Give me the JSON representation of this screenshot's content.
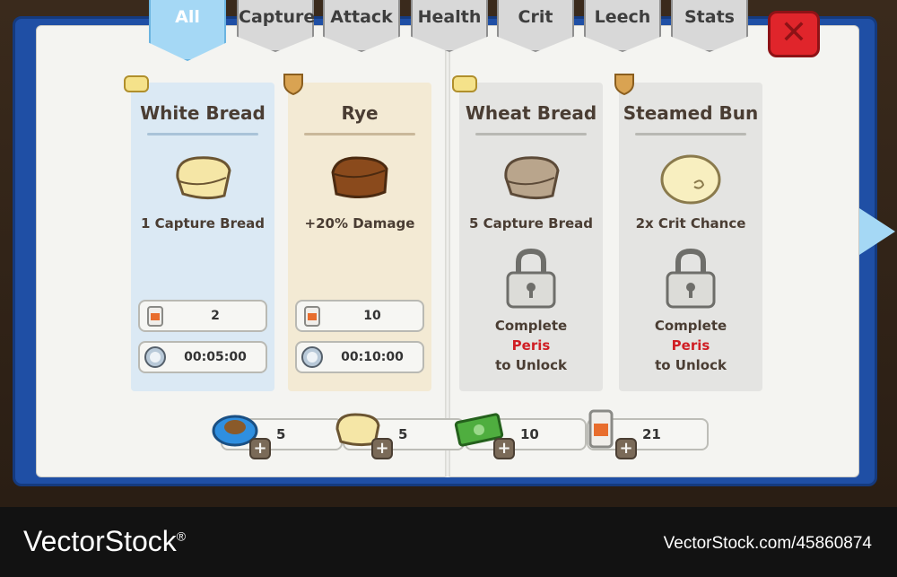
{
  "tabs": [
    {
      "label": "All",
      "active": true
    },
    {
      "label": "Capture"
    },
    {
      "label": "Attack"
    },
    {
      "label": "Health"
    },
    {
      "label": "Crit"
    },
    {
      "label": "Leech"
    },
    {
      "label": "Stats"
    }
  ],
  "close_label": "✕",
  "cards": [
    {
      "title": "White Bread",
      "effect": "1 Capture Bread",
      "count": "2",
      "time": "00:05:00",
      "color": "#dbe9f4",
      "rule_color": "#a9c3d8"
    },
    {
      "title": "Rye",
      "effect": "+20% Damage",
      "count": "10",
      "time": "00:10:00",
      "color": "#f3ead4",
      "rule_color": "#c9b89a"
    },
    {
      "title": "Wheat Bread",
      "effect": "5 Capture Bread",
      "locked": true,
      "unlock_lines": [
        "Complete",
        "Peris",
        "to Unlock"
      ],
      "color": "#e4e4e2",
      "rule_color": "#b8b8b3"
    },
    {
      "title": "Steamed Bun",
      "effect": "2x Crit Chance",
      "locked": true,
      "unlock_lines": [
        "Complete",
        "Peris",
        "to Unlock"
      ],
      "color": "#e4e4e2",
      "rule_color": "#b8b8b3"
    }
  ],
  "resources": [
    {
      "icon": "blue-bread-icon",
      "value": "5"
    },
    {
      "icon": "white-bread-icon",
      "value": "5"
    },
    {
      "icon": "cash-icon",
      "value": "10"
    },
    {
      "icon": "flour-bag-icon",
      "value": "21"
    }
  ],
  "watermark": {
    "brand": "VectorStock",
    "brand_reg": "®",
    "id": "VectorStock.com/45860874"
  },
  "colors": {
    "tab_active": "#a5d8f5",
    "book_blue": "#1f4fa5",
    "close_red": "#e0252b",
    "requirement_red": "#d01e24"
  }
}
